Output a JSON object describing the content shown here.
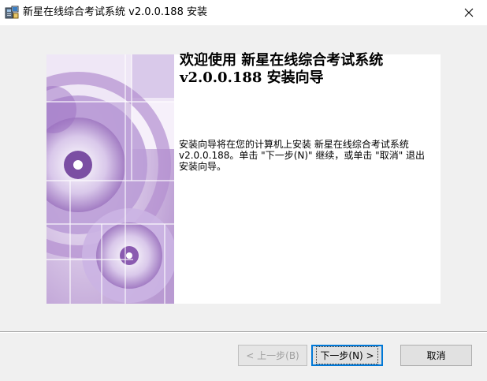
{
  "window": {
    "title": "新星在线综合考试系统 v2.0.0.188 安装",
    "close_glyph": "✕"
  },
  "welcome": {
    "title_line1": "欢迎使用 新星在线综合考试系统",
    "title_line2": "v2.0.0.188 安装向导",
    "body_line1": "安装向导将在您的计算机上安装 新星在线综合考试系统",
    "body_line2": " v2.0.0.188。单击 \"下一步(N)\" 继续，或单击 \"取消\" 退出",
    "body_line3": "安装向导。"
  },
  "buttons": {
    "back": "< 上一步(B)",
    "next": "下一步(N) >",
    "cancel": "取消"
  },
  "colors": {
    "accent": "#0078d7",
    "image_purple": "#8a5ab0"
  },
  "icons": {
    "app": "installer-computer-icon",
    "close": "close-icon"
  }
}
